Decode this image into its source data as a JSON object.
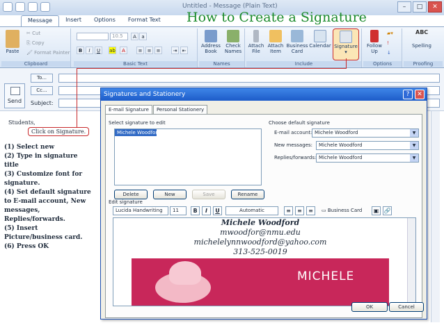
{
  "window": {
    "title": "Untitled - Message (Plain Text)"
  },
  "slide_title": "How to Create a Signature",
  "tabs": [
    {
      "label": "Message"
    },
    {
      "label": "Insert"
    },
    {
      "label": "Options"
    },
    {
      "label": "Format Text"
    }
  ],
  "ribbon": {
    "clipboard": {
      "paste": "Paste",
      "cut": "Cut",
      "copy": "Copy",
      "format_painter": "Format Painter",
      "label": "Clipboard"
    },
    "basic_text": {
      "font_size": "10.5",
      "label": "Basic Text"
    },
    "names": {
      "address_book": "Address Book",
      "check_names": "Check Names",
      "label": "Names"
    },
    "include": {
      "attach_file": "Attach File",
      "attach_item": "Attach Item",
      "business_card": "Business Card",
      "calendar": "Calendar",
      "signature": "Signature",
      "label": "Include"
    },
    "options": {
      "follow_up": "Follow Up",
      "label": "Options"
    },
    "proofing": {
      "spelling": "Spelling",
      "label": "Proofing"
    }
  },
  "header": {
    "send": "Send",
    "to": "To...",
    "cc": "Cc...",
    "subject": "Subject:"
  },
  "body": {
    "greeting": "Students,",
    "callout": "Click on Signature."
  },
  "instructions": [
    "(1) Select new",
    "(2) Type in signature",
    "title",
    "(3) Customize font for",
    "signature.",
    "(4) Set default signature",
    "to E-mail account, New",
    "messages,",
    "Replies/forwards.",
    "(5) Insert",
    "Picture/business card.",
    "(6) Press OK"
  ],
  "dialog": {
    "title": "Signatures and Stationery",
    "tab_email": "E-mail Signature",
    "tab_stationery": "Personal Stationery",
    "select_label": "Select signature to edit",
    "selected_signature": "Michele Woodford",
    "delete": "Delete",
    "new": "New",
    "save": "Save",
    "rename": "Rename",
    "default_label": "Choose default signature",
    "email_account_label": "E-mail account:",
    "email_account": "Michele Woodford",
    "new_messages_label": "New messages:",
    "new_messages": "Michele Woodford",
    "replies_label": "Replies/forwards:",
    "replies": "Michele Woodford",
    "edit_label": "Edit signature",
    "font": "Lucida Handwriting",
    "font_size": "11",
    "bold": "B",
    "italic": "I",
    "underline": "U",
    "color": "Automatic",
    "business_card": "Business Card",
    "ok": "OK",
    "cancel": "Cancel"
  },
  "signature": {
    "name": "Michele Woodford",
    "email1": "mwoodfor@nmu.edu",
    "email2": "michelelynnwoodford@yahoo.com",
    "phone": "313-525-0019",
    "card_name": "MICHELE"
  },
  "colors": {
    "title_green": "#1a8a2a",
    "callout_red": "#c8282a",
    "card_pink": "#c8275a",
    "dialog_blue": "#1d5cc9"
  }
}
